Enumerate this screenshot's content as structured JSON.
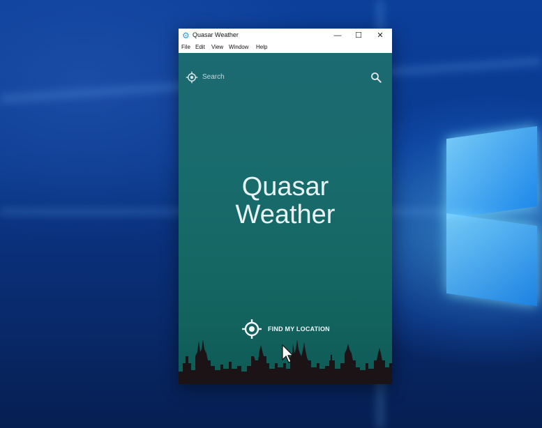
{
  "window": {
    "title": "Quasar Weather",
    "icon": "gear-app-icon",
    "controls": {
      "minimize": "—",
      "maximize": "☐",
      "close": "✕"
    }
  },
  "menu": [
    "File",
    "Edit",
    "View",
    "Window",
    "Help"
  ],
  "search": {
    "placeholder": "Search",
    "left_icon": "location-target-icon",
    "right_icon": "search-icon"
  },
  "main": {
    "title_line1": "Quasar",
    "title_line2": "Weather",
    "find_location_label": "FIND MY LOCATION",
    "find_location_icon": "location-target-icon"
  },
  "colors": {
    "app_bg_top": "#1c6a72",
    "app_bg_bottom": "#0f5b56",
    "skyline": "#1b1316",
    "text": "#e9f3f3"
  }
}
